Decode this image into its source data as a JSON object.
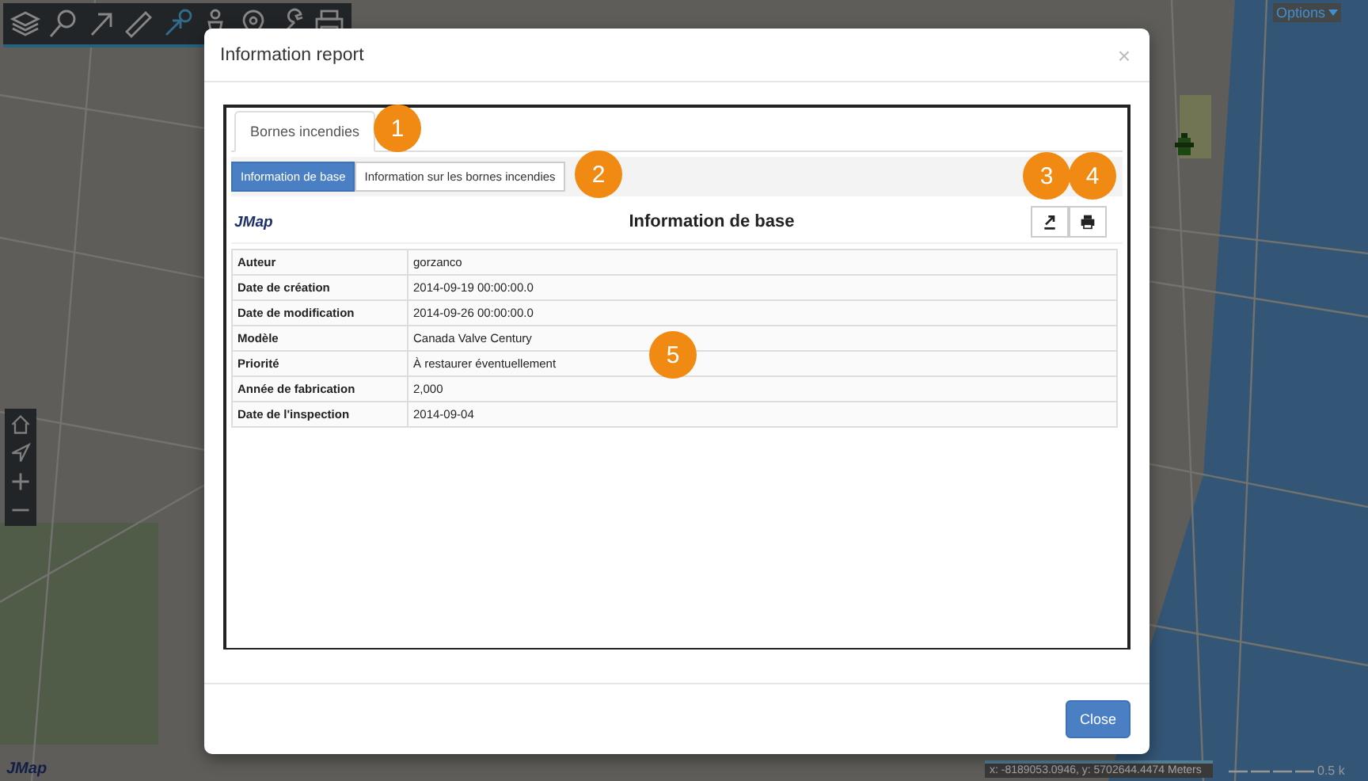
{
  "map": {
    "options_label": "Options",
    "logo": "JMap",
    "coordinates": "x: -8189053.0946, y: 5702644.4474 Meters",
    "scale_label": "0.5 k"
  },
  "dialog": {
    "title": "Information report",
    "close_glyph": "×",
    "tabs": [
      {
        "label": "Bornes incendies",
        "selected": true
      }
    ],
    "sections": [
      {
        "label": "Information de base",
        "selected": true
      },
      {
        "label": "Information sur les bornes incendies",
        "selected": false
      }
    ],
    "report": {
      "logo": "JMap",
      "title": "Information de base",
      "rows": [
        {
          "field": "Auteur",
          "value": "gorzanco"
        },
        {
          "field": "Date de création",
          "value": "2014-09-19 00:00:00.0"
        },
        {
          "field": "Date de modification",
          "value": "2014-09-26 00:00:00.0"
        },
        {
          "field": "Modèle",
          "value": "Canada Valve Century"
        },
        {
          "field": "Priorité",
          "value": "À restaurer éventuellement"
        },
        {
          "field": "Année de fabrication",
          "value": "2,000"
        },
        {
          "field": "Date de l'inspection",
          "value": "2014-09-04"
        }
      ]
    },
    "close_button": "Close"
  },
  "callouts": [
    {
      "label": "1"
    },
    {
      "label": "2"
    },
    {
      "label": "3"
    },
    {
      "label": "4"
    },
    {
      "label": "5"
    }
  ]
}
